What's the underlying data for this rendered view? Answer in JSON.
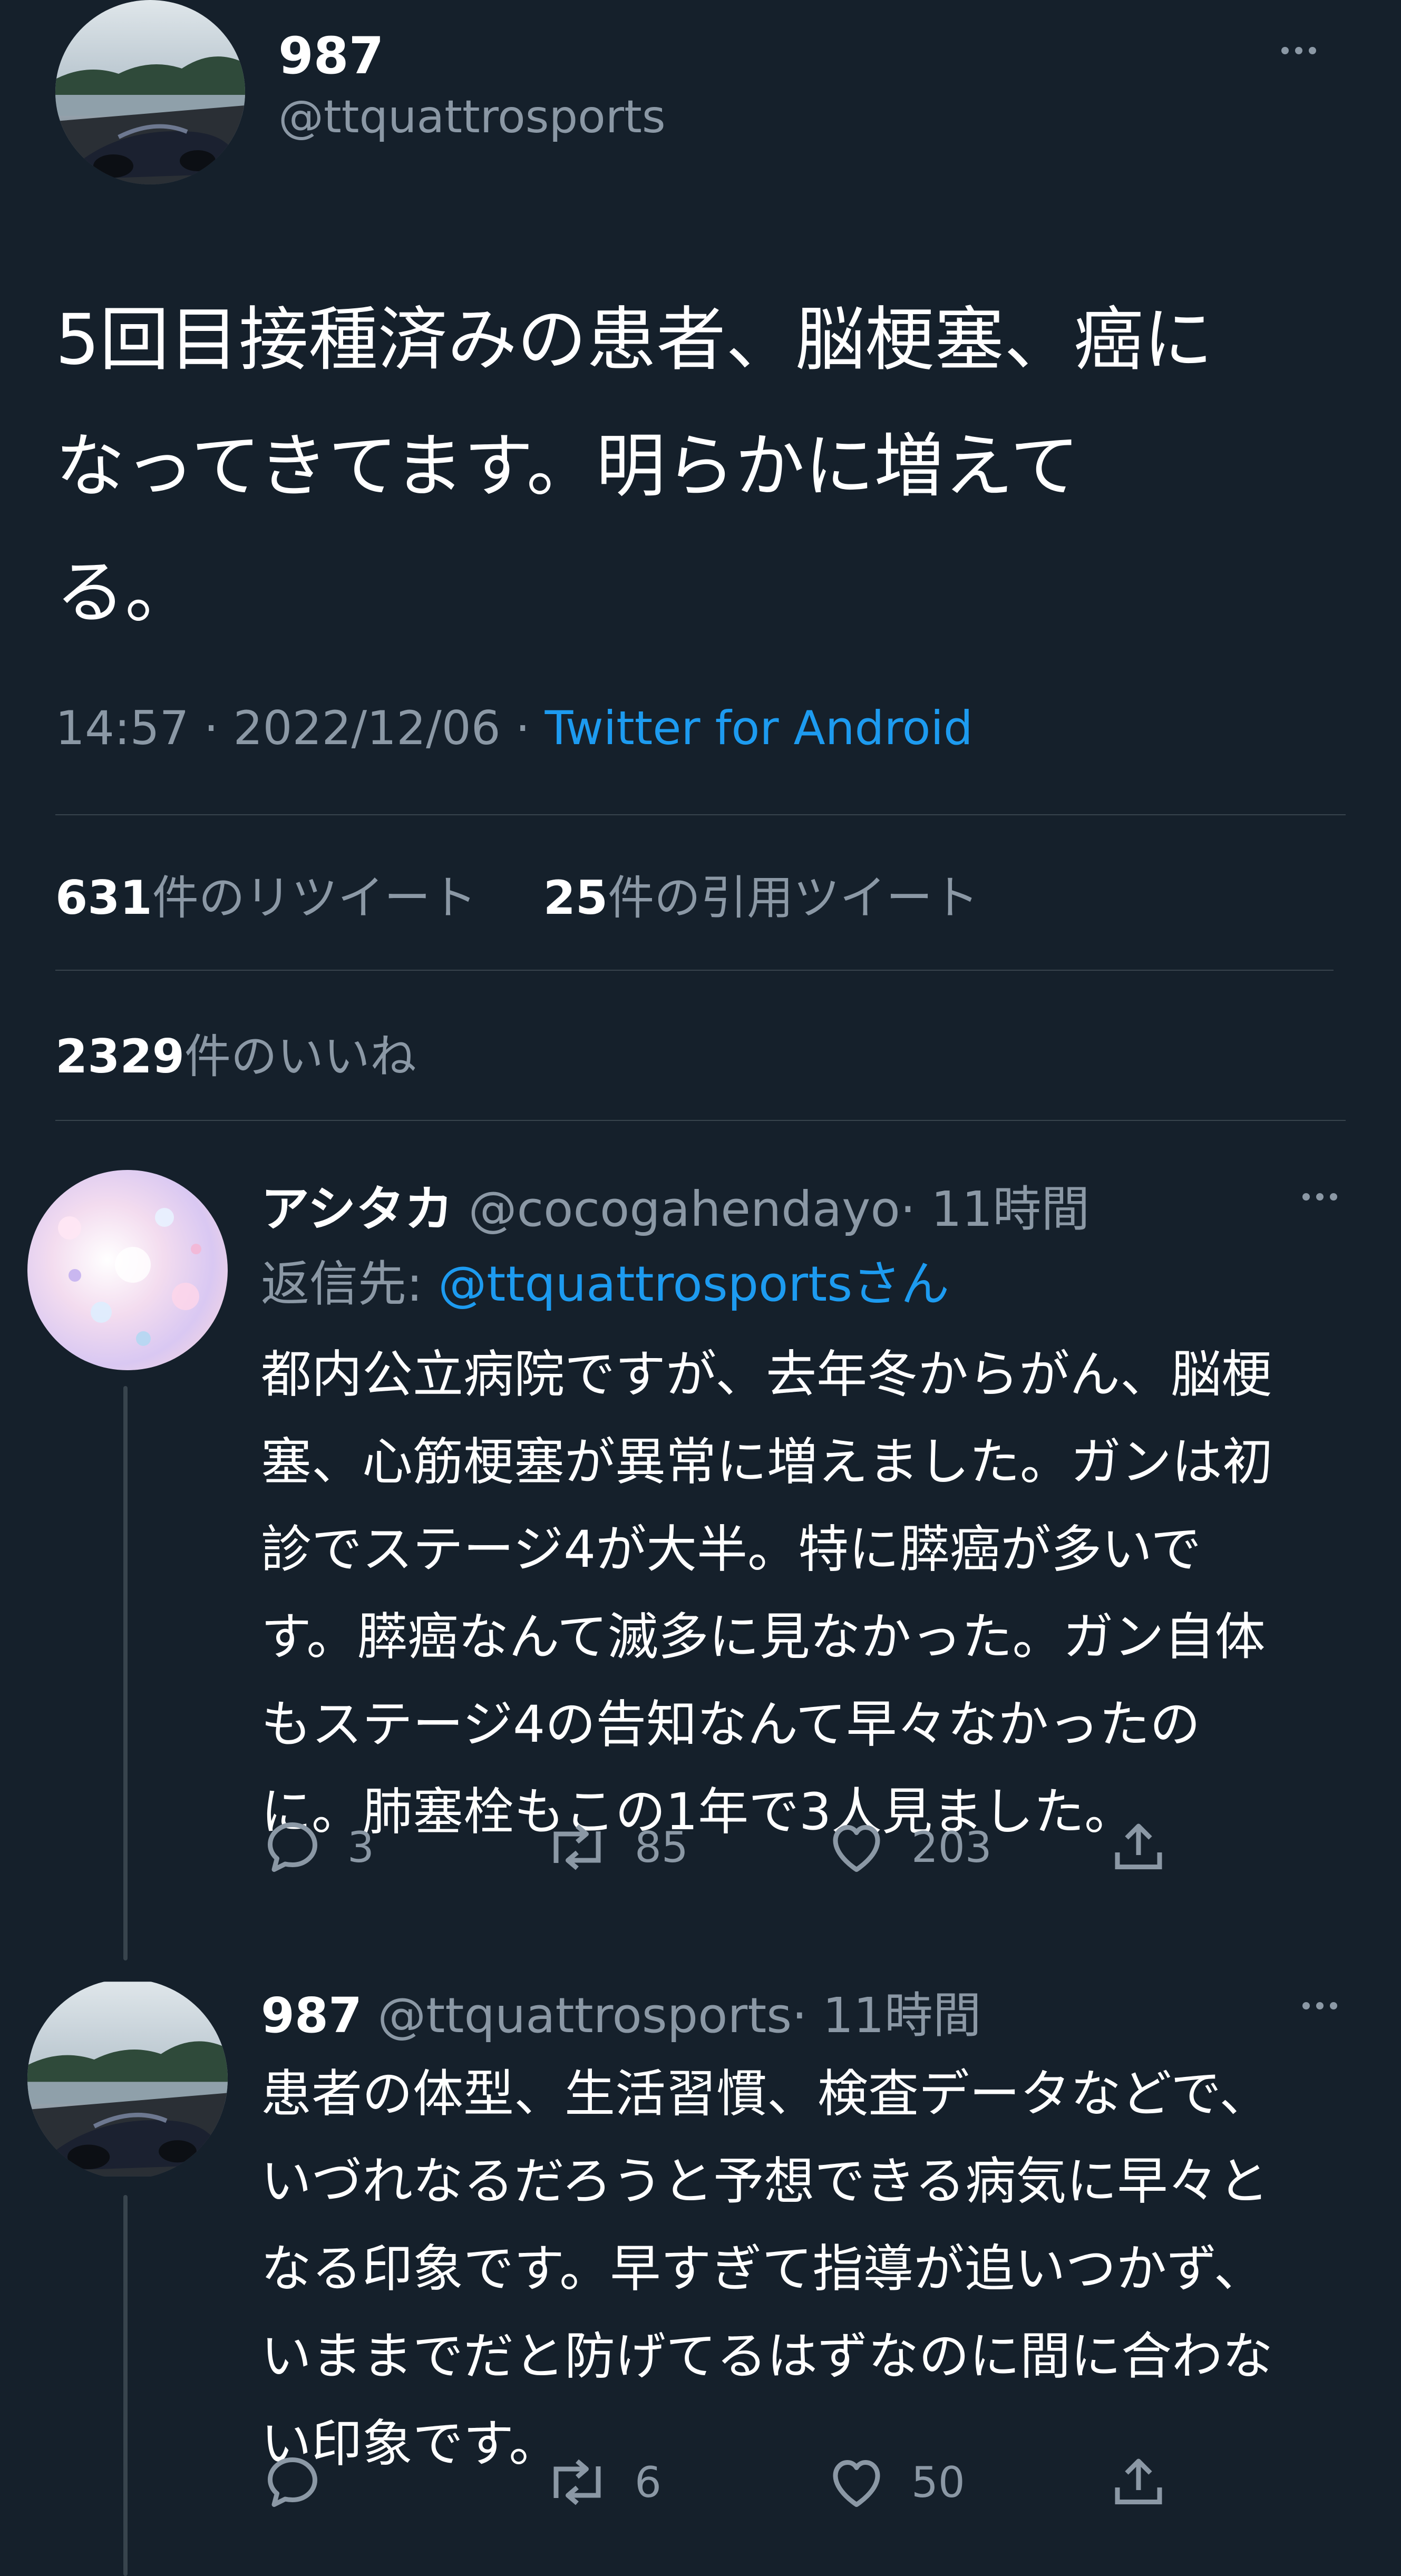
{
  "main_tweet": {
    "display_name": "987",
    "handle": "@ttquattrosports",
    "text_lines": [
      "5回目接種済みの患者、脳梗塞、癌に",
      "なってきてます。明らかに増えて",
      "る。"
    ],
    "time": "14:57",
    "sep1": " · ",
    "date": "2022/12/06",
    "sep2": " · ",
    "source": "Twitter for Android",
    "retweets_count": "631",
    "retweets_label": "件のリツイート",
    "quotes_count": "25",
    "quotes_label": "件の引用ツイート",
    "likes_count": "2329",
    "likes_label": "件のいいね"
  },
  "replies": [
    {
      "display_name": "アシタカ",
      "handle": "@cocogahendayo",
      "time": "· 11時間",
      "reply_to_prefix": "返信先: ",
      "reply_to": "@ttquattrosportsさん",
      "text_lines": [
        "都内公立病院ですが、去年冬からがん、脳梗",
        "塞、心筋梗塞が異常に増えました。ガンは初",
        "診でステージ4が大半。特に膵癌が多いで",
        "す。膵癌なんて滅多に見なかった。ガン自体",
        "もステージ4の告知なんて早々なかったの",
        "に。肺塞栓もこの1年で3人見ました。"
      ],
      "reply_count": "3",
      "retweet_count": "85",
      "like_count": "203"
    },
    {
      "display_name": "987",
      "handle": "@ttquattrosports",
      "time": "· 11時間",
      "text_lines": [
        "患者の体型、生活習慣、検査データなどで、",
        "いづれなるだろうと予想できる病気に早々と",
        "なる印象です。早すぎて指導が追いつかず、",
        "いままでだと防げてるはずなのに間に合わな",
        "い印象です。"
      ],
      "reply_count": "",
      "retweet_count": "6",
      "like_count": "50"
    }
  ],
  "icons": {
    "more": "more-dots-icon",
    "reply": "reply-bubble-icon",
    "retweet": "retweet-arrows-icon",
    "like": "heart-icon",
    "share": "share-upload-icon"
  },
  "colors": {
    "background": "#15202b",
    "text": "#ffffff",
    "muted": "#8b98a5",
    "link": "#1d9bf0",
    "divider": "#38444d"
  }
}
